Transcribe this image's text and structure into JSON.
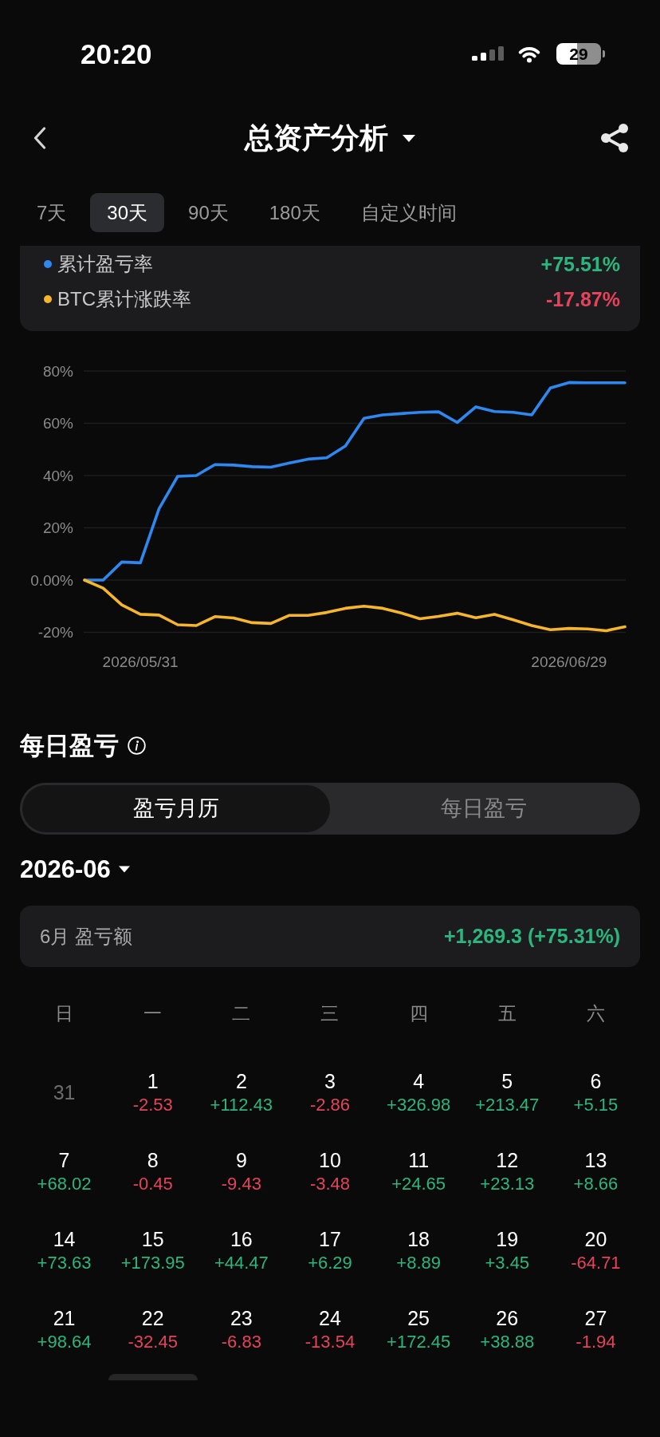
{
  "status_bar": {
    "time": "20:20",
    "battery": "29"
  },
  "header": {
    "title": "总资产分析"
  },
  "tabs": [
    {
      "label": "7天",
      "selected": false
    },
    {
      "label": "30天",
      "selected": true
    },
    {
      "label": "90天",
      "selected": false
    },
    {
      "label": "180天",
      "selected": false
    },
    {
      "label": "自定义时间",
      "selected": false
    }
  ],
  "performance": {
    "legend": [
      {
        "value": "+75.51%",
        "negative": false
      },
      {
        "value": "-17.87%",
        "negative": true
      }
    ],
    "chart_data": {
      "type": "line",
      "grid": true,
      "categories": [
        null,
        null,
        null,
        "2026/05/31",
        null,
        null,
        null,
        null,
        null,
        null,
        null,
        null,
        null,
        null,
        null,
        null,
        null,
        null,
        null,
        null,
        null,
        null,
        null,
        null,
        null,
        null,
        "2026/06/29",
        null,
        null,
        null
      ],
      "ylim": [
        -20,
        80
      ],
      "yticks": [
        {
          "value": 80,
          "label": "80%"
        },
        {
          "value": 60,
          "label": "60%"
        },
        {
          "value": 40,
          "label": "40%"
        },
        {
          "value": 20,
          "label": "20%"
        },
        {
          "value": 0,
          "label": "0.00%"
        },
        {
          "value": -20,
          "label": "-20%"
        }
      ],
      "series": [
        {
          "name": "累计盈亏率",
          "color": "#2f88ef",
          "values": [
            0,
            0,
            6.9,
            6.6,
            27.3,
            39.7,
            40.0,
            44.2,
            44.0,
            43.4,
            43.2,
            44.8,
            46.3,
            46.8,
            51.3,
            61.9,
            63.2,
            63.7,
            64.2,
            64.4,
            60.3,
            66.3,
            64.5,
            64.2,
            63.2,
            73.5,
            75.6,
            75.5,
            75.5,
            75.5
          ]
        },
        {
          "name": "BTC累计涨跌率",
          "color": "#f5b52c",
          "values": [
            0,
            -3.1,
            -9.5,
            -13.1,
            -13.4,
            -17.1,
            -17.4,
            -14.0,
            -14.5,
            -16.3,
            -16.6,
            -13.5,
            -13.5,
            -12.4,
            -10.8,
            -10.0,
            -10.8,
            -12.6,
            -14.8,
            -13.9,
            -12.7,
            -14.4,
            -13.1,
            -15.2,
            -17.4,
            -19.0,
            -18.5,
            -18.7,
            -19.4,
            -17.9
          ]
        }
      ]
    }
  },
  "daily_pnl": {
    "title": "每日盈亏",
    "view_switch": [
      {
        "label": "盈亏月历",
        "selected": true
      },
      {
        "label": "每日盈亏",
        "selected": false
      }
    ],
    "month": "2026-06",
    "summary": {
      "label": "6月 盈亏额",
      "value": "+1,269.3 (+75.31%)",
      "negative": false
    },
    "calendar": {
      "weekdays": [
        "日",
        "一",
        "二",
        "三",
        "四",
        "五",
        "六"
      ],
      "weeks": [
        {
          "days": [
            {
              "day": "31",
              "in_month": false
            },
            {
              "day": "1",
              "in_month": true,
              "pnl": "-2.53",
              "negative": true
            },
            {
              "day": "2",
              "in_month": true,
              "pnl": "+112.43",
              "negative": false
            },
            {
              "day": "3",
              "in_month": true,
              "pnl": "-2.86",
              "negative": true
            },
            {
              "day": "4",
              "in_month": true,
              "pnl": "+326.98",
              "negative": false
            },
            {
              "day": "5",
              "in_month": true,
              "pnl": "+213.47",
              "negative": false
            },
            {
              "day": "6",
              "in_month": true,
              "pnl": "+5.15",
              "negative": false
            }
          ]
        },
        {
          "days": [
            {
              "day": "7",
              "in_month": true,
              "pnl": "+68.02",
              "negative": false
            },
            {
              "day": "8",
              "in_month": true,
              "pnl": "-0.45",
              "negative": true
            },
            {
              "day": "9",
              "in_month": true,
              "pnl": "-9.43",
              "negative": true
            },
            {
              "day": "10",
              "in_month": true,
              "pnl": "-3.48",
              "negative": true
            },
            {
              "day": "11",
              "in_month": true,
              "pnl": "+24.65",
              "negative": false
            },
            {
              "day": "12",
              "in_month": true,
              "pnl": "+23.13",
              "negative": false
            },
            {
              "day": "13",
              "in_month": true,
              "pnl": "+8.66",
              "negative": false
            }
          ]
        },
        {
          "days": [
            {
              "day": "14",
              "in_month": true,
              "pnl": "+73.63",
              "negative": false
            },
            {
              "day": "15",
              "in_month": true,
              "pnl": "+173.95",
              "negative": false
            },
            {
              "day": "16",
              "in_month": true,
              "pnl": "+44.47",
              "negative": false
            },
            {
              "day": "17",
              "in_month": true,
              "pnl": "+6.29",
              "negative": false
            },
            {
              "day": "18",
              "in_month": true,
              "pnl": "+8.89",
              "negative": false
            },
            {
              "day": "19",
              "in_month": true,
              "pnl": "+3.45",
              "negative": false
            },
            {
              "day": "20",
              "in_month": true,
              "pnl": "-64.71",
              "negative": true
            }
          ]
        },
        {
          "days": [
            {
              "day": "21",
              "in_month": true,
              "pnl": "+98.64",
              "negative": false
            },
            {
              "day": "22",
              "in_month": true,
              "pnl": "-32.45",
              "negative": true
            },
            {
              "day": "23",
              "in_month": true,
              "pnl": "-6.83",
              "negative": true
            },
            {
              "day": "24",
              "in_month": true,
              "pnl": "-13.54",
              "negative": true
            },
            {
              "day": "25",
              "in_month": true,
              "pnl": "+172.45",
              "negative": false
            },
            {
              "day": "26",
              "in_month": true,
              "pnl": "+38.88",
              "negative": false
            },
            {
              "day": "27",
              "in_month": true,
              "pnl": "-1.94",
              "negative": true
            }
          ]
        }
      ]
    }
  }
}
